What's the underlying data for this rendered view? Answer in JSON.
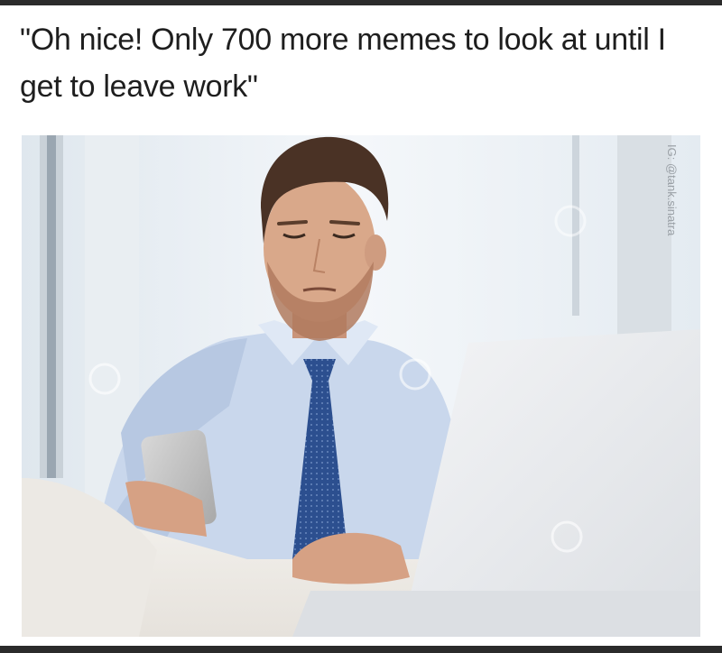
{
  "meme": {
    "caption": "\"Oh nice! Only 700 more memes to look at until I get to leave work\"",
    "watermark_credit": "IG: @tank.sinatra"
  },
  "colors": {
    "frame": "#2b2b2b",
    "caption_text": "#1e1e1e",
    "shirt": "#c9d7ec",
    "tie": "#2c4f8f",
    "hair": "#4a3225",
    "skin": "#d9a88a",
    "laptop": "#e9ebee"
  }
}
